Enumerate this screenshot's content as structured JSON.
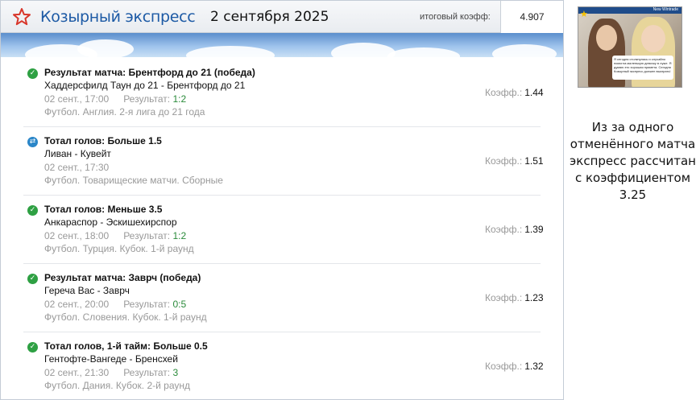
{
  "header": {
    "brand": "Козырный экспресс",
    "date": "2 сентября 2025",
    "total_label": "итоговый коэфф:",
    "total_value": "4.907"
  },
  "coef_label": "Коэфф.:",
  "result_label": "Результат:",
  "bets": [
    {
      "status": "won",
      "title": "Результат матча: Брентфорд до 21 (победа)",
      "teams": "Хаддерсфилд Таун до 21 - Брентфорд до 21",
      "time": "02 сент., 17:00",
      "score": "1:2",
      "league": "Футбол. Англия. 2-я лига до 21 года",
      "coef": "1.44"
    },
    {
      "status": "returned",
      "title": "Тотал голов: Больше 1.5",
      "teams": "Ливан - Кувейт",
      "time": "02 сент., 17:30",
      "score": "",
      "league": "Футбол. Товарищеские матчи. Сборные",
      "coef": "1.51"
    },
    {
      "status": "won",
      "title": "Тотал голов: Меньше 3.5",
      "teams": "Анкараспор - Эскишехирспор",
      "time": "02 сент., 18:00",
      "score": "1:2",
      "league": "Футбол. Турция. Кубок. 1-й раунд",
      "coef": "1.39"
    },
    {
      "status": "won",
      "title": "Результат матча: Заврч (победа)",
      "teams": "Гереча Вас - Заврч",
      "time": "02 сент., 20:00",
      "score": "0:5",
      "league": "Футбол. Словения. Кубок. 1-й раунд",
      "coef": "1.23"
    },
    {
      "status": "won",
      "title": "Тотал голов, 1-й тайм: Больше 0.5",
      "teams": "Гентофте-Вангеде - Бренсхей",
      "time": "02 сент., 21:30",
      "score": "3",
      "league": "Футбол. Дания. Кубок. 2-й раунд",
      "coef": "1.32"
    }
  ],
  "side": {
    "image_tag": "New Wintrade",
    "image_caption": "Я сегодня столкнулась и случайно помогла маленькую девочку в луже. Я думаю это хорошая примета. Сегодня Козырный экспресс должен выиграть!",
    "note": "Из за одного отменённого матча экспресс рассчитан с коэффициентом 3.25"
  },
  "colors": {
    "brand": "#1d5aa5",
    "won": "#2ea043",
    "returned": "#2a86c8",
    "score": "#2a8a3a"
  }
}
